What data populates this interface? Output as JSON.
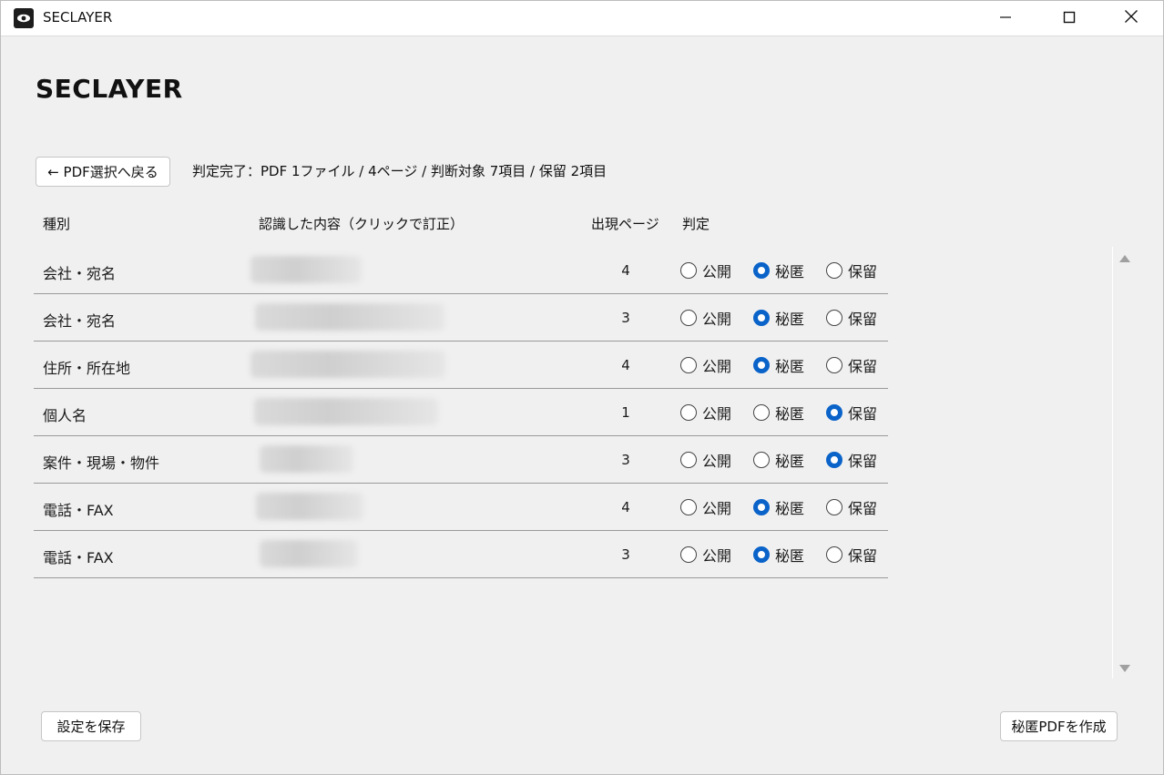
{
  "window": {
    "title": "SECLAYER"
  },
  "page": {
    "heading": "SECLAYER",
    "back_button": "← PDF選択へ戻る",
    "status": "判定完了：PDF 1ファイル / 4ページ / 判断対象 7項目 / 保留 2項目"
  },
  "table": {
    "headers": {
      "type": "種別",
      "content": "認識した内容（クリックで訂正）",
      "page": "出現ページ",
      "judgement": "判定"
    },
    "options": [
      "公開",
      "秘匿",
      "保留"
    ],
    "rows": [
      {
        "type": "会社・宛名",
        "content": "",
        "page": "4",
        "selected": "秘匿"
      },
      {
        "type": "会社・宛名",
        "content": "",
        "page": "3",
        "selected": "秘匿"
      },
      {
        "type": "住所・所在地",
        "content": "",
        "page": "4",
        "selected": "秘匿"
      },
      {
        "type": "個人名",
        "content": "",
        "page": "1",
        "selected": "保留"
      },
      {
        "type": "案件・現場・物件",
        "content": "",
        "page": "3",
        "selected": "保留"
      },
      {
        "type": "電話・FAX",
        "content": "",
        "page": "4",
        "selected": "秘匿"
      },
      {
        "type": "電話・FAX",
        "content": "",
        "page": "3",
        "selected": "秘匿"
      }
    ]
  },
  "footer": {
    "save_button": "設定を保存",
    "create_button": "秘匿PDFを作成"
  },
  "colors": {
    "accent": "#0a63c9",
    "background": "#f0f0f0"
  },
  "icons": {
    "app": "eye-icon",
    "minimize": "minimize-icon",
    "maximize": "maximize-icon",
    "close": "close-icon",
    "scroll_up": "scroll-up-arrow-icon",
    "scroll_down": "scroll-down-arrow-icon"
  }
}
